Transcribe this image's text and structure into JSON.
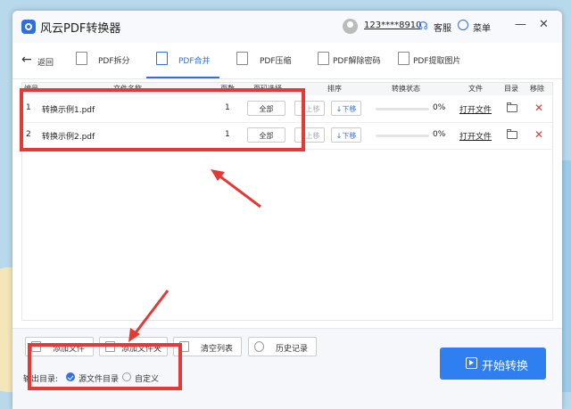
{
  "colors": {
    "accent": "#2f6fe4",
    "start_button": "#2f7ff0",
    "annotation": "#e53935",
    "delete": "#e53935"
  },
  "titlebar": {
    "app_title": "风云PDF转换器",
    "user": "123****8910",
    "service_label": "客服",
    "menu_label": "菜单",
    "minimize": "—",
    "close": "✕"
  },
  "toolbar": {
    "back_label": "返回",
    "tabs": [
      {
        "label": "PDF拆分",
        "icon": "split-icon",
        "active": false
      },
      {
        "label": "PDF合并",
        "icon": "merge-icon",
        "active": true
      },
      {
        "label": "PDF压缩",
        "icon": "compress-icon",
        "active": false
      },
      {
        "label": "PDF解除密码",
        "icon": "unlock-icon",
        "active": false
      },
      {
        "label": "PDF提取图片",
        "icon": "image-icon",
        "active": false
      }
    ]
  },
  "table": {
    "headers": {
      "index": "编号",
      "filename": "文件名称",
      "pages": "页数",
      "page_select": "页码选择",
      "order": "排序",
      "status": "转换状态",
      "file": "文件",
      "dir": "目录",
      "remove": "移除"
    },
    "rows": [
      {
        "index": "1",
        "filename": "转换示例1.pdf",
        "pages": "1",
        "page_select": "全部",
        "up": "↑上移",
        "down": "↓下移",
        "progress_text": "0%",
        "progress": 0,
        "open": "打开文件"
      },
      {
        "index": "2",
        "filename": "转换示例2.pdf",
        "pages": "1",
        "page_select": "全部",
        "up": "↑上移",
        "down": "↓下移",
        "progress_text": "0%",
        "progress": 0,
        "open": "打开文件"
      }
    ]
  },
  "bottom": {
    "add_file": "添加文件",
    "add_folder": "添加文件夹",
    "clear_list": "清空列表",
    "history": "历史记录",
    "output_label": "输出目录:",
    "option_source": "源文件目录",
    "option_custom": "自定义",
    "selected_option": "源文件目录",
    "start_label": "开始转换"
  }
}
